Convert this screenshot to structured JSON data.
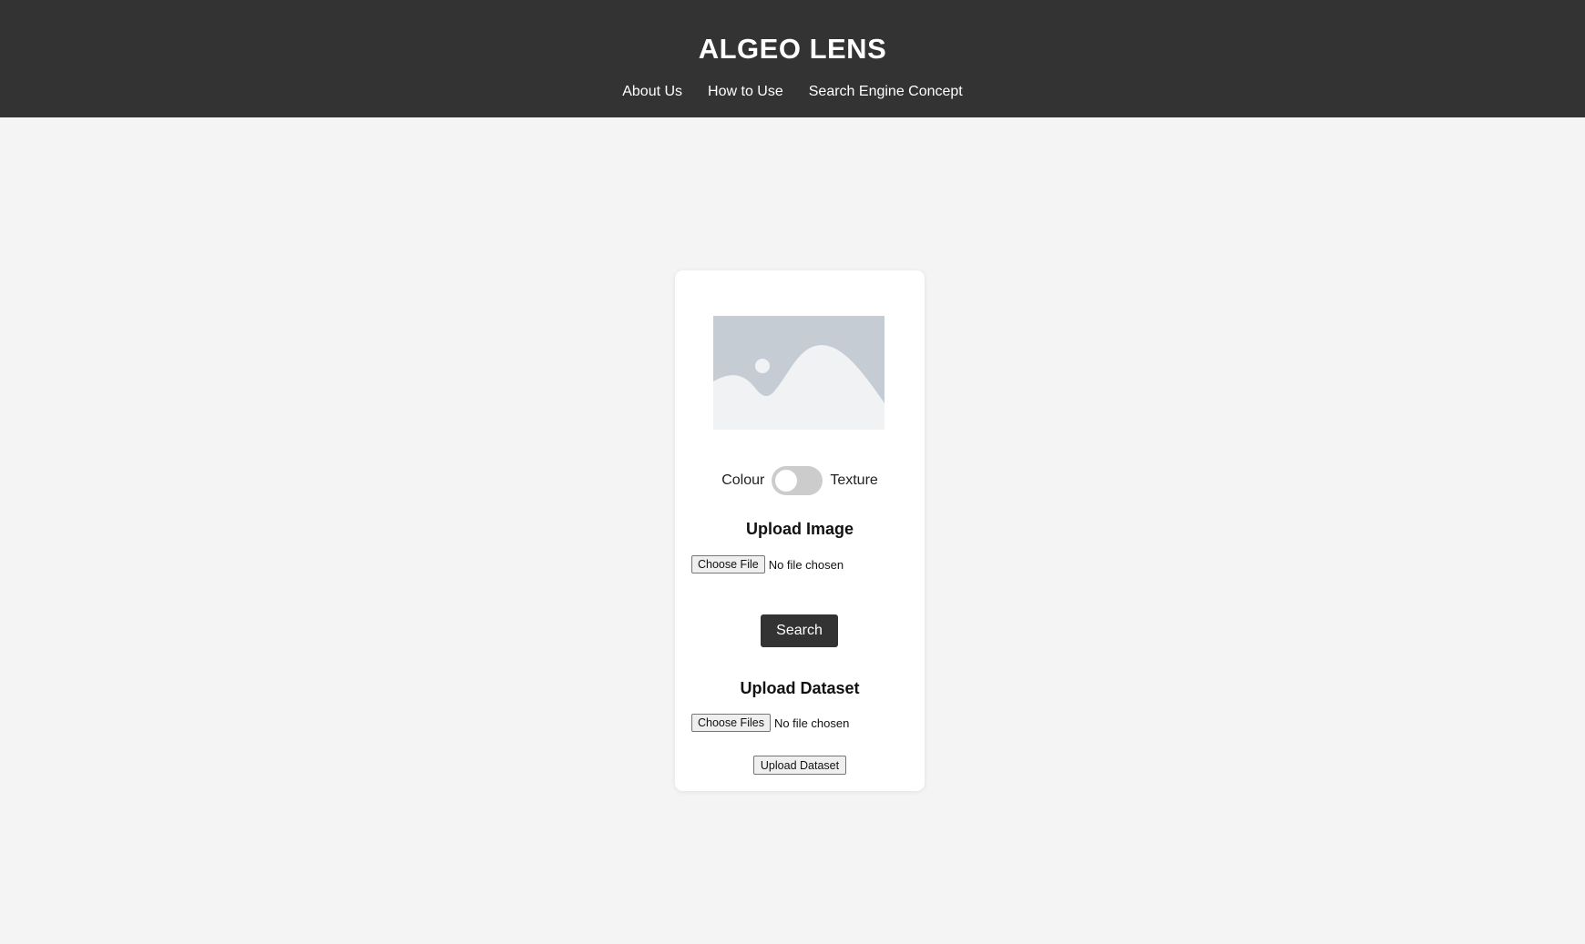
{
  "header": {
    "title": "ALGEO LENS",
    "nav": [
      "About Us",
      "How to Use",
      "Search Engine Concept"
    ]
  },
  "card": {
    "placeholder_icon": "image-placeholder-icon",
    "toggle": {
      "left_label": "Colour",
      "right_label": "Texture",
      "checked": false
    },
    "upload_image": {
      "title": "Upload Image",
      "button_label": "Choose File",
      "status": "No file chosen"
    },
    "search_label": "Search",
    "upload_dataset": {
      "title": "Upload Dataset",
      "button_label": "Choose Files",
      "status": "No file chosen",
      "submit_label": "Upload Dataset"
    }
  },
  "colors": {
    "header_bg": "#333333",
    "page_bg": "#f4f4f4",
    "card_bg": "#ffffff",
    "button_dark": "#333333",
    "placeholder_bg": "#c5ccd3",
    "placeholder_fg": "#f1f2f4"
  }
}
